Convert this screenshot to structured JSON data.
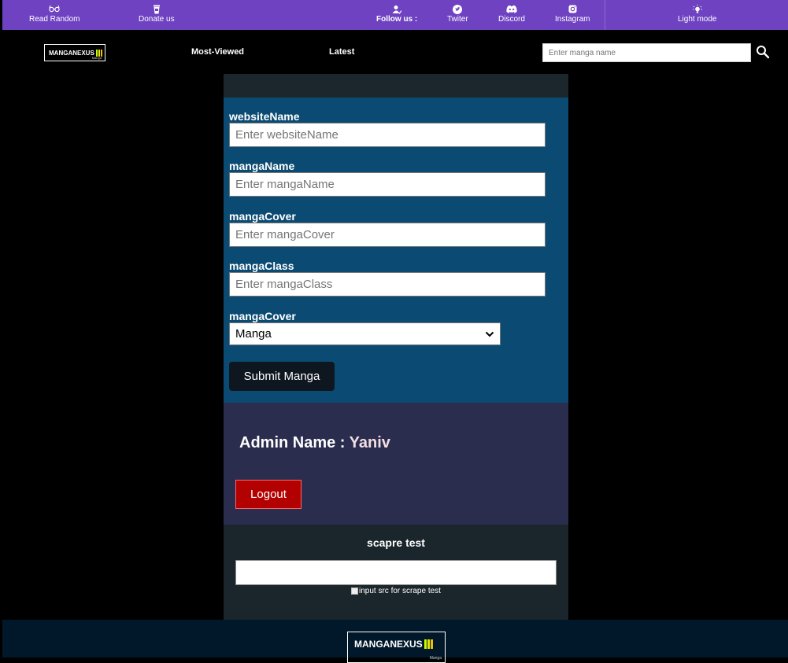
{
  "topbar": {
    "read_random": "Read Random",
    "donate": "Donate us",
    "follow": "Follow us :",
    "twitter": "Twiter",
    "discord": "Discord",
    "instagram": "Instagram",
    "light_mode": "Light mode"
  },
  "nav": {
    "logo_text": "MANGANEXUS",
    "logo_sub": "Manga",
    "most_viewed": "Most-Viewed",
    "latest": "Latest",
    "search_placeholder": "Enter manga name"
  },
  "form": {
    "fields": [
      {
        "label": "websiteName",
        "placeholder": "Enter websiteName"
      },
      {
        "label": "mangaName",
        "placeholder": "Enter mangaName"
      },
      {
        "label": "mangaCover",
        "placeholder": "Enter mangaCover"
      },
      {
        "label": "mangaClass",
        "placeholder": "Enter mangaClass"
      }
    ],
    "select_label": "mangaCover",
    "select_value": "Manga",
    "submit_label": "Submit Manga"
  },
  "admin": {
    "label": "Admin Name : ",
    "name": "Yaniv",
    "logout_label": "Logout"
  },
  "scrape": {
    "title": "scapre test",
    "img_alt": "input src for scrape test"
  },
  "footer": {
    "logo_text": "MANGANEXUS",
    "logo_sub": "Manga"
  },
  "colors": {
    "topbar": "#6f42c1",
    "form_panel": "#0b4b73",
    "admin_panel": "#2b2d4e",
    "logout": "#b30000",
    "footer": "#001829"
  }
}
